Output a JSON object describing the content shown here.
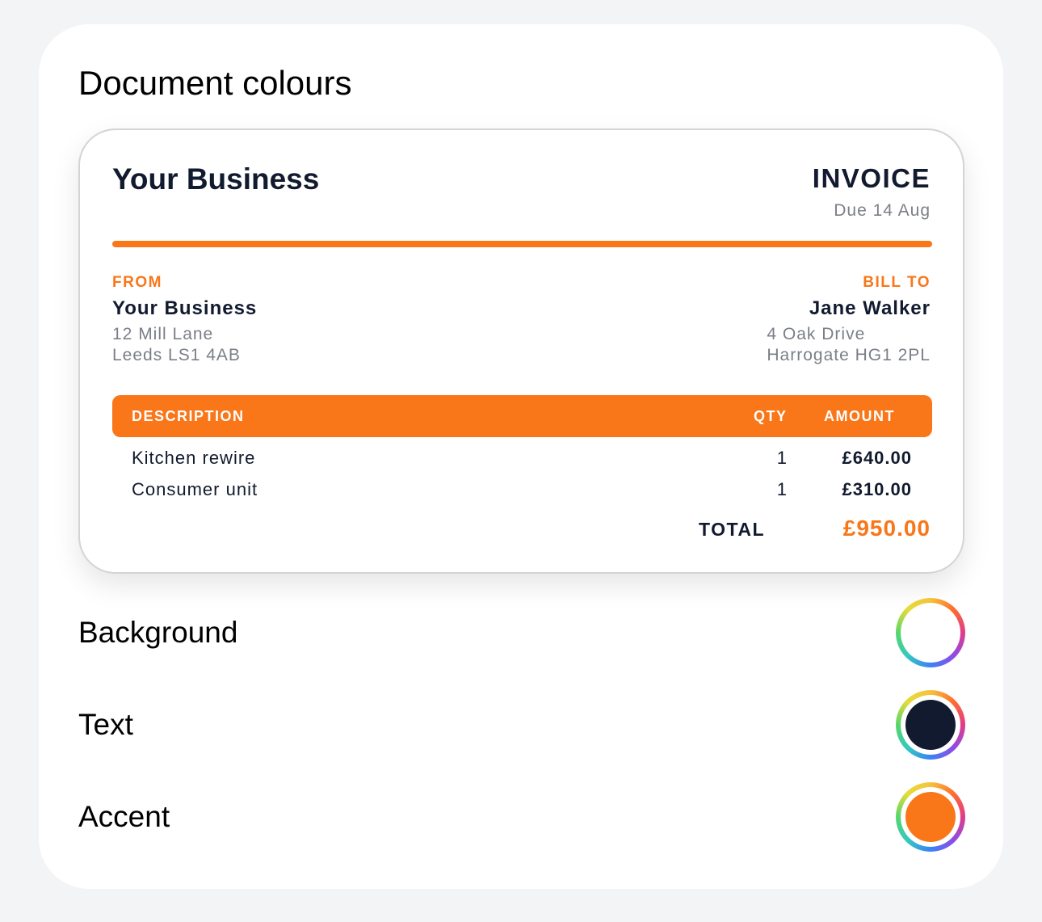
{
  "section": {
    "title": "Document colours"
  },
  "invoice": {
    "business_name": "Your Business",
    "title": "INVOICE",
    "due": "Due 14 Aug",
    "from": {
      "label": "FROM",
      "name": "Your Business",
      "address_line1": "12 Mill Lane",
      "address_line2": "Leeds LS1 4AB"
    },
    "bill_to": {
      "label": "BILL TO",
      "name": "Jane Walker",
      "address_line1": "4 Oak Drive",
      "address_line2": "Harrogate HG1 2PL"
    },
    "columns": {
      "description": "DESCRIPTION",
      "qty": "QTY",
      "amount": "AMOUNT"
    },
    "line_items": [
      {
        "description": "Kitchen rewire",
        "qty": "1",
        "amount": "£640.00"
      },
      {
        "description": "Consumer unit",
        "qty": "1",
        "amount": "£310.00"
      }
    ],
    "total_label": "TOTAL",
    "total_value": "£950.00"
  },
  "colour_settings": [
    {
      "label": "Background",
      "color": "#ffffff"
    },
    {
      "label": "Text",
      "color": "#111a2e"
    },
    {
      "label": "Accent",
      "color": "#f97619"
    }
  ],
  "icons": {
    "colour_picker": "colour-wheel-icon"
  }
}
